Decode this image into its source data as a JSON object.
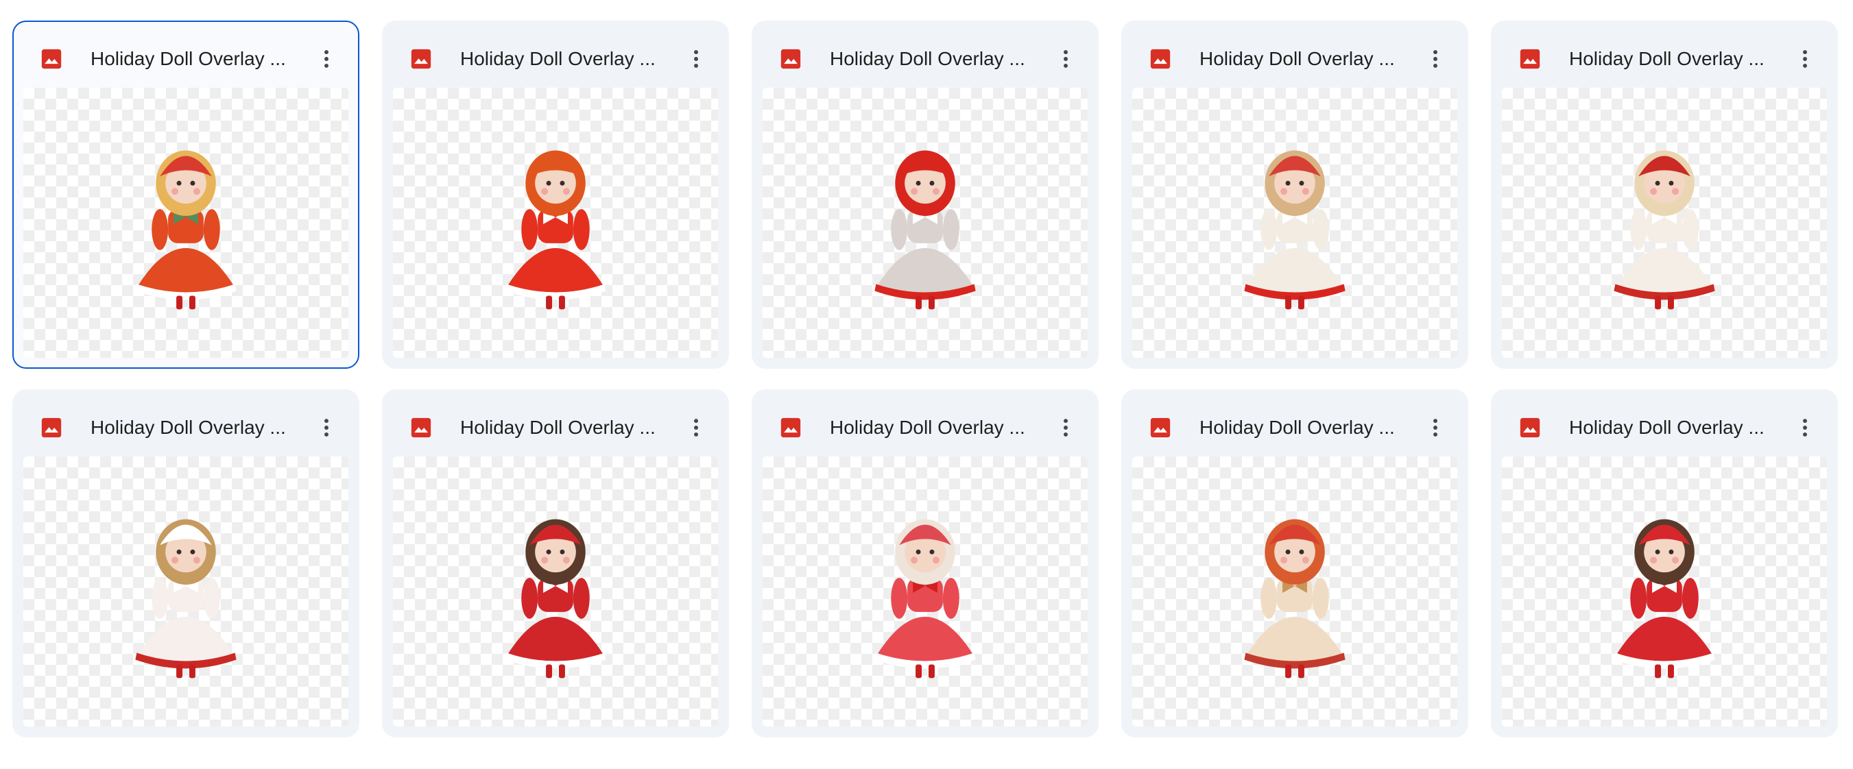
{
  "files": [
    {
      "name": "Holiday Doll Overlay ...",
      "icon": "image-file-icon",
      "selected": true,
      "hair": "#e8b45a",
      "hat": "#d93b2f",
      "dress": "#e24a22",
      "trim": "#ffffff",
      "accent": "#5a8a5a"
    },
    {
      "name": "Holiday Doll Overlay ...",
      "icon": "image-file-icon",
      "selected": false,
      "hair": "#e0551e",
      "hat": "#e0551e",
      "dress": "#e5301f",
      "trim": "#ffffff",
      "accent": "#ffffff"
    },
    {
      "name": "Holiday Doll Overlay ...",
      "icon": "image-file-icon",
      "selected": false,
      "hair": "#d8261f",
      "hat": "#d8261f",
      "dress": "#d9d2cf",
      "trim": "#d8261f",
      "accent": "#ffffff"
    },
    {
      "name": "Holiday Doll Overlay ...",
      "icon": "image-file-icon",
      "selected": false,
      "hair": "#d9b384",
      "hat": "#d83f35",
      "dress": "#f3ece3",
      "trim": "#d8261f",
      "accent": "#ffffff"
    },
    {
      "name": "Holiday Doll Overlay ...",
      "icon": "image-file-icon",
      "selected": false,
      "hair": "#ead6b2",
      "hat": "#cc2a24",
      "dress": "#f5eee6",
      "trim": "#cc2a24",
      "accent": "#ffffff"
    },
    {
      "name": "Holiday Doll Overlay ...",
      "icon": "image-file-icon",
      "selected": false,
      "hair": "#c59b60",
      "hat": "#ffffff",
      "dress": "#f7efec",
      "trim": "#c92a26",
      "accent": "#ffffff"
    },
    {
      "name": "Holiday Doll Overlay ...",
      "icon": "image-file-icon",
      "selected": false,
      "hair": "#5a3a2a",
      "hat": "#d0262a",
      "dress": "#d0262a",
      "trim": "#ffffff",
      "accent": "#ffffff"
    },
    {
      "name": "Holiday Doll Overlay ...",
      "icon": "image-file-icon",
      "selected": false,
      "hair": "#efe4da",
      "hat": "#df4a52",
      "dress": "#e84a52",
      "trim": "#ffffff",
      "accent": "#d21f1f"
    },
    {
      "name": "Holiday Doll Overlay ...",
      "icon": "image-file-icon",
      "selected": false,
      "hair": "#d95c2e",
      "hat": "#d9402f",
      "dress": "#f0dcc4",
      "trim": "#c23b2c",
      "accent": "#c8955a"
    },
    {
      "name": "Holiday Doll Overlay ...",
      "icon": "image-file-icon",
      "selected": false,
      "hair": "#5a3a2a",
      "hat": "#d6272c",
      "dress": "#d6272c",
      "trim": "#ffffff",
      "accent": "#ffffff"
    }
  ],
  "colors": {
    "card_bg": "#f0f4f9",
    "selected_border": "#0b57d0",
    "image_icon": "#d93025",
    "text": "#1f1f1f",
    "more_icon": "#444746"
  }
}
